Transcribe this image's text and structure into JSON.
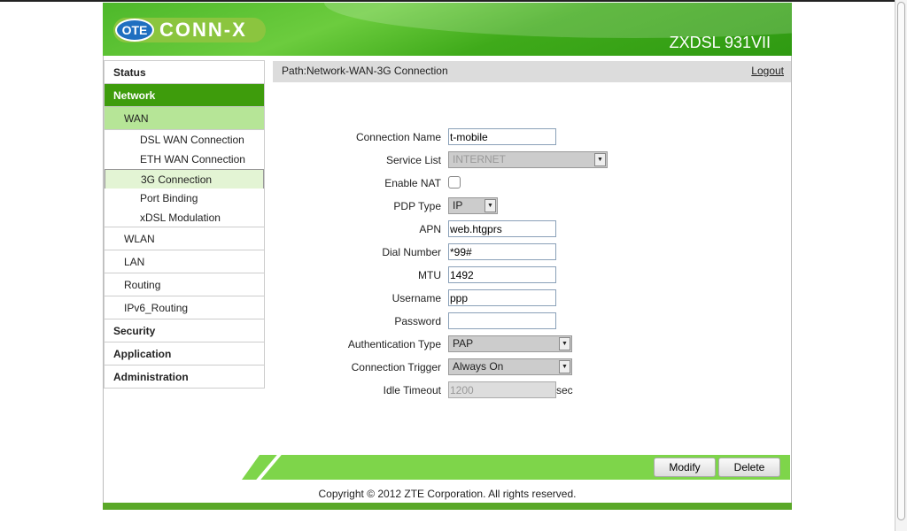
{
  "header": {
    "logo_prefix": "OTE",
    "logo_text": "CONN-X",
    "model": "ZXDSL 931VII"
  },
  "sidebar": {
    "items": [
      {
        "label": "Status",
        "level": "top"
      },
      {
        "label": "Network",
        "level": "top",
        "active": true
      },
      {
        "label": "WAN",
        "level": "sub",
        "active": true
      },
      {
        "label": "DSL WAN Connection",
        "level": "sub2"
      },
      {
        "label": "ETH WAN Connection",
        "level": "sub2"
      },
      {
        "label": "3G Connection",
        "level": "sub2",
        "selected": true
      },
      {
        "label": "Port Binding",
        "level": "sub2"
      },
      {
        "label": "xDSL Modulation",
        "level": "sub2"
      },
      {
        "label": "WLAN",
        "level": "sub"
      },
      {
        "label": "LAN",
        "level": "sub"
      },
      {
        "label": "Routing",
        "level": "sub"
      },
      {
        "label": "IPv6_Routing",
        "level": "sub"
      },
      {
        "label": "Security",
        "level": "top"
      },
      {
        "label": "Application",
        "level": "top"
      },
      {
        "label": "Administration",
        "level": "top"
      }
    ]
  },
  "path": {
    "text": "Path:Network-WAN-3G Connection",
    "logout": "Logout"
  },
  "form": {
    "connection_name": {
      "label": "Connection Name",
      "value": "t-mobile"
    },
    "service_list": {
      "label": "Service List",
      "value": "INTERNET"
    },
    "enable_nat": {
      "label": "Enable NAT",
      "checked": false
    },
    "pdp_type": {
      "label": "PDP Type",
      "value": "IP"
    },
    "apn": {
      "label": "APN",
      "value": "web.htgprs"
    },
    "dial_number": {
      "label": "Dial Number",
      "value": "*99#"
    },
    "mtu": {
      "label": "MTU",
      "value": "1492"
    },
    "username": {
      "label": "Username",
      "value": "ppp"
    },
    "password": {
      "label": "Password",
      "value": ""
    },
    "auth_type": {
      "label": "Authentication Type",
      "value": "PAP"
    },
    "trigger": {
      "label": "Connection Trigger",
      "value": "Always On"
    },
    "idle_timeout": {
      "label": "Idle Timeout",
      "value": "1200",
      "unit": "sec"
    }
  },
  "buttons": {
    "modify": "Modify",
    "delete": "Delete"
  },
  "footer": {
    "copyright": "Copyright © 2012 ZTE Corporation. All rights reserved."
  }
}
